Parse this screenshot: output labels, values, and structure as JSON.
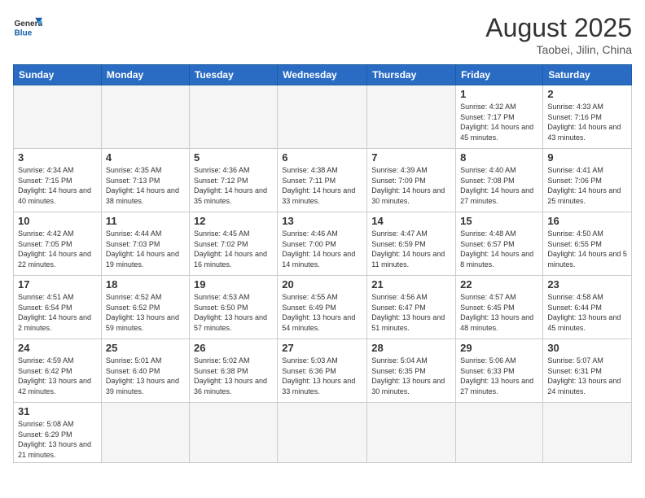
{
  "header": {
    "logo_general": "General",
    "logo_blue": "Blue",
    "month_title": "August 2025",
    "location": "Taobei, Jilin, China"
  },
  "days_of_week": [
    "Sunday",
    "Monday",
    "Tuesday",
    "Wednesday",
    "Thursday",
    "Friday",
    "Saturday"
  ],
  "weeks": [
    [
      {
        "day": "",
        "info": ""
      },
      {
        "day": "",
        "info": ""
      },
      {
        "day": "",
        "info": ""
      },
      {
        "day": "",
        "info": ""
      },
      {
        "day": "",
        "info": ""
      },
      {
        "day": "1",
        "info": "Sunrise: 4:32 AM\nSunset: 7:17 PM\nDaylight: 14 hours and 45 minutes."
      },
      {
        "day": "2",
        "info": "Sunrise: 4:33 AM\nSunset: 7:16 PM\nDaylight: 14 hours and 43 minutes."
      }
    ],
    [
      {
        "day": "3",
        "info": "Sunrise: 4:34 AM\nSunset: 7:15 PM\nDaylight: 14 hours and 40 minutes."
      },
      {
        "day": "4",
        "info": "Sunrise: 4:35 AM\nSunset: 7:13 PM\nDaylight: 14 hours and 38 minutes."
      },
      {
        "day": "5",
        "info": "Sunrise: 4:36 AM\nSunset: 7:12 PM\nDaylight: 14 hours and 35 minutes."
      },
      {
        "day": "6",
        "info": "Sunrise: 4:38 AM\nSunset: 7:11 PM\nDaylight: 14 hours and 33 minutes."
      },
      {
        "day": "7",
        "info": "Sunrise: 4:39 AM\nSunset: 7:09 PM\nDaylight: 14 hours and 30 minutes."
      },
      {
        "day": "8",
        "info": "Sunrise: 4:40 AM\nSunset: 7:08 PM\nDaylight: 14 hours and 27 minutes."
      },
      {
        "day": "9",
        "info": "Sunrise: 4:41 AM\nSunset: 7:06 PM\nDaylight: 14 hours and 25 minutes."
      }
    ],
    [
      {
        "day": "10",
        "info": "Sunrise: 4:42 AM\nSunset: 7:05 PM\nDaylight: 14 hours and 22 minutes."
      },
      {
        "day": "11",
        "info": "Sunrise: 4:44 AM\nSunset: 7:03 PM\nDaylight: 14 hours and 19 minutes."
      },
      {
        "day": "12",
        "info": "Sunrise: 4:45 AM\nSunset: 7:02 PM\nDaylight: 14 hours and 16 minutes."
      },
      {
        "day": "13",
        "info": "Sunrise: 4:46 AM\nSunset: 7:00 PM\nDaylight: 14 hours and 14 minutes."
      },
      {
        "day": "14",
        "info": "Sunrise: 4:47 AM\nSunset: 6:59 PM\nDaylight: 14 hours and 11 minutes."
      },
      {
        "day": "15",
        "info": "Sunrise: 4:48 AM\nSunset: 6:57 PM\nDaylight: 14 hours and 8 minutes."
      },
      {
        "day": "16",
        "info": "Sunrise: 4:50 AM\nSunset: 6:55 PM\nDaylight: 14 hours and 5 minutes."
      }
    ],
    [
      {
        "day": "17",
        "info": "Sunrise: 4:51 AM\nSunset: 6:54 PM\nDaylight: 14 hours and 2 minutes."
      },
      {
        "day": "18",
        "info": "Sunrise: 4:52 AM\nSunset: 6:52 PM\nDaylight: 13 hours and 59 minutes."
      },
      {
        "day": "19",
        "info": "Sunrise: 4:53 AM\nSunset: 6:50 PM\nDaylight: 13 hours and 57 minutes."
      },
      {
        "day": "20",
        "info": "Sunrise: 4:55 AM\nSunset: 6:49 PM\nDaylight: 13 hours and 54 minutes."
      },
      {
        "day": "21",
        "info": "Sunrise: 4:56 AM\nSunset: 6:47 PM\nDaylight: 13 hours and 51 minutes."
      },
      {
        "day": "22",
        "info": "Sunrise: 4:57 AM\nSunset: 6:45 PM\nDaylight: 13 hours and 48 minutes."
      },
      {
        "day": "23",
        "info": "Sunrise: 4:58 AM\nSunset: 6:44 PM\nDaylight: 13 hours and 45 minutes."
      }
    ],
    [
      {
        "day": "24",
        "info": "Sunrise: 4:59 AM\nSunset: 6:42 PM\nDaylight: 13 hours and 42 minutes."
      },
      {
        "day": "25",
        "info": "Sunrise: 5:01 AM\nSunset: 6:40 PM\nDaylight: 13 hours and 39 minutes."
      },
      {
        "day": "26",
        "info": "Sunrise: 5:02 AM\nSunset: 6:38 PM\nDaylight: 13 hours and 36 minutes."
      },
      {
        "day": "27",
        "info": "Sunrise: 5:03 AM\nSunset: 6:36 PM\nDaylight: 13 hours and 33 minutes."
      },
      {
        "day": "28",
        "info": "Sunrise: 5:04 AM\nSunset: 6:35 PM\nDaylight: 13 hours and 30 minutes."
      },
      {
        "day": "29",
        "info": "Sunrise: 5:06 AM\nSunset: 6:33 PM\nDaylight: 13 hours and 27 minutes."
      },
      {
        "day": "30",
        "info": "Sunrise: 5:07 AM\nSunset: 6:31 PM\nDaylight: 13 hours and 24 minutes."
      }
    ],
    [
      {
        "day": "31",
        "info": "Sunrise: 5:08 AM\nSunset: 6:29 PM\nDaylight: 13 hours and 21 minutes."
      },
      {
        "day": "",
        "info": ""
      },
      {
        "day": "",
        "info": ""
      },
      {
        "day": "",
        "info": ""
      },
      {
        "day": "",
        "info": ""
      },
      {
        "day": "",
        "info": ""
      },
      {
        "day": "",
        "info": ""
      }
    ]
  ]
}
